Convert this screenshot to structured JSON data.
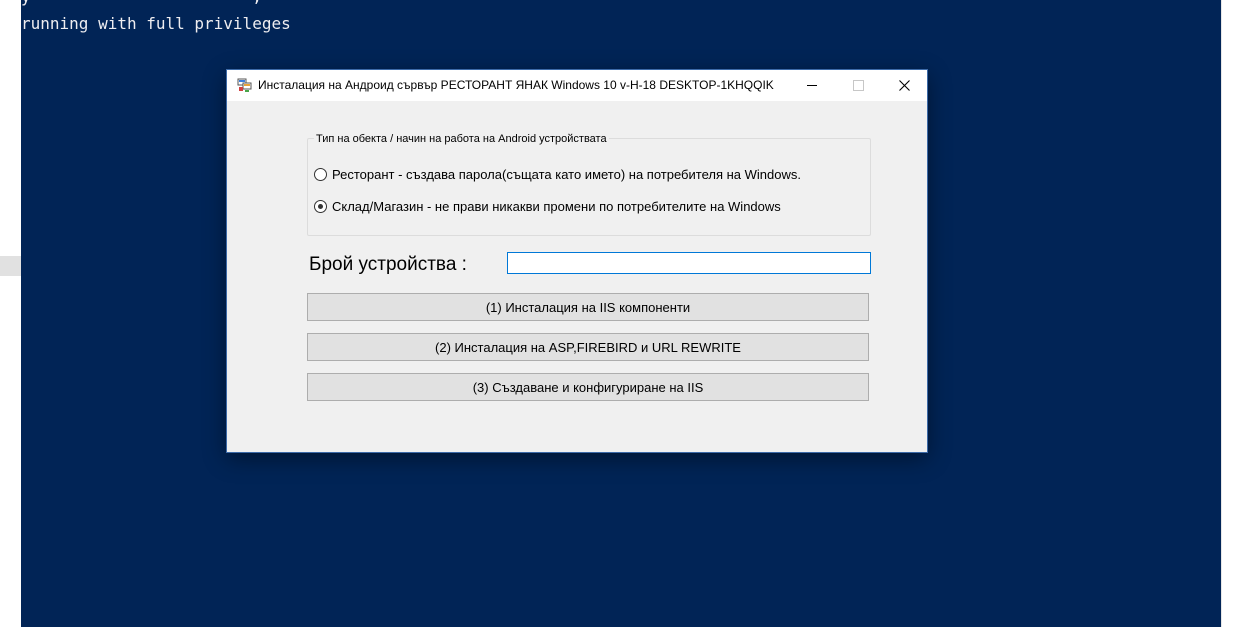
{
  "console": {
    "partial_line": "y                       ,                                  ",
    "line": "running with full privileges"
  },
  "dialog": {
    "title": "Инсталация на Андроид сървър РЕСТОРАНТ ЯНАК Windows 10 v-H-18 DESKTOP-1KHQQIK",
    "controls": {
      "minimize": "—",
      "maximize": "☐",
      "close": "✕"
    },
    "group": {
      "legend": "Тип на обекта / начин на работа на Android устройствата",
      "options": [
        {
          "label": "Ресторант  - създава парола(същата като името) на потребителя на Windows.",
          "checked": false
        },
        {
          "label": "Склад/Магазин  - не прави никакви промени по потребителите на Windows",
          "checked": true
        }
      ]
    },
    "device_count": {
      "label": "Брой устройства :",
      "value": "",
      "placeholder": ""
    },
    "buttons": [
      "(1) Инсталация на IIS компоненти",
      "(2) Инсталация на ASP,FIREBIRD и URL REWRITE",
      "(3) Създаване и конфигуриране на IIS"
    ]
  },
  "colors": {
    "console_bg": "#012456",
    "console_text": "#eeedf0",
    "dialog_bg": "#f0f0f0",
    "button_bg": "#e1e1e1",
    "focus_border": "#0078d7"
  }
}
